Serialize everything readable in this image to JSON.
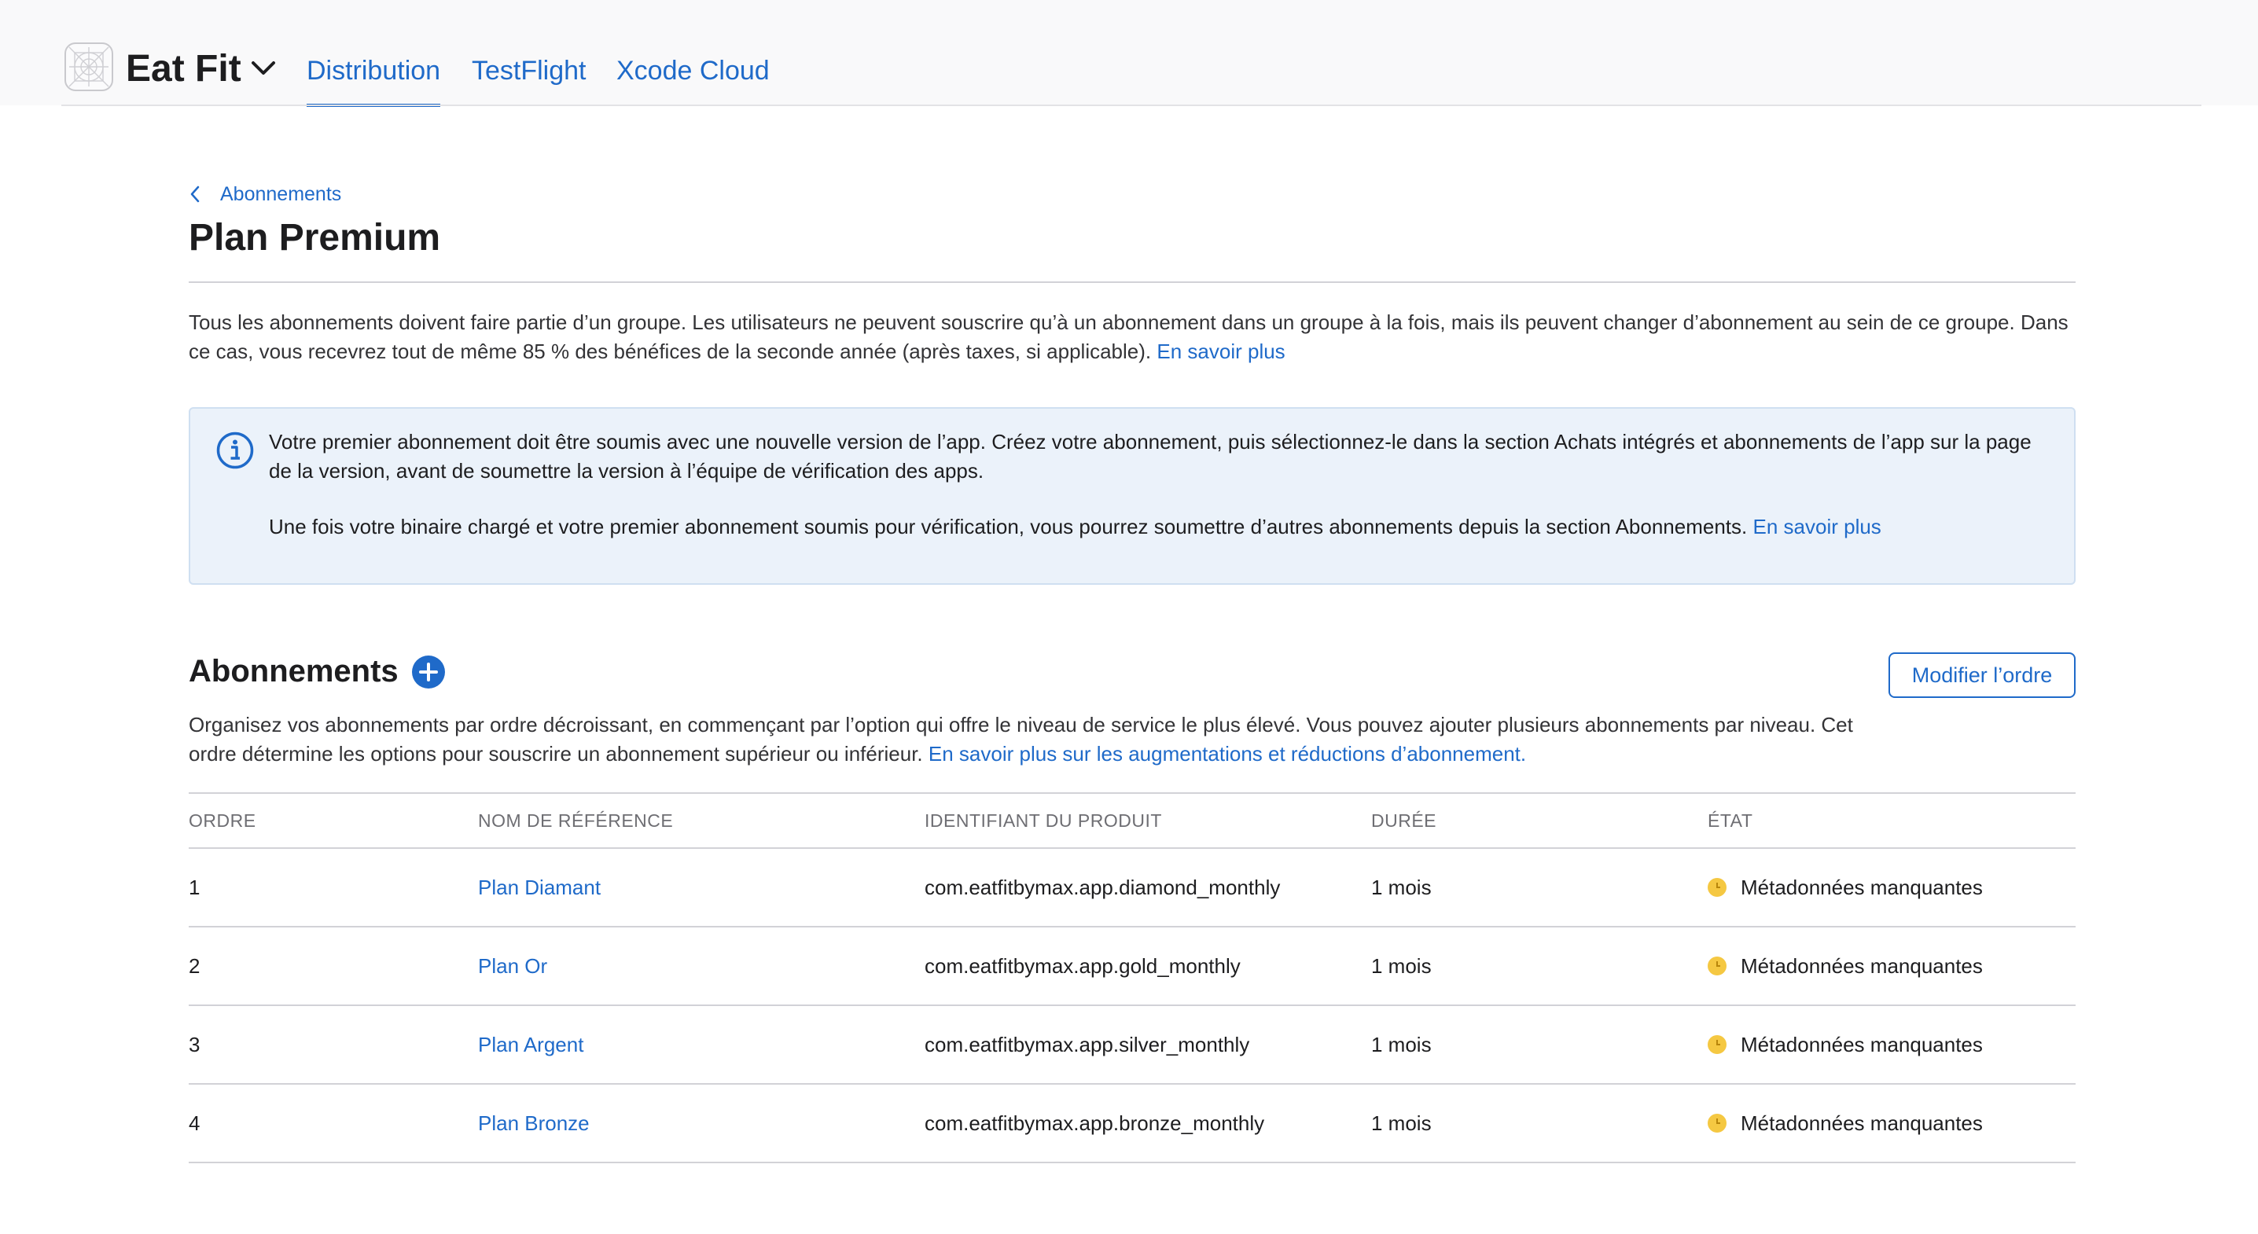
{
  "header": {
    "app_name": "Eat Fit",
    "tabs": [
      {
        "label": "Distribution",
        "active": true
      },
      {
        "label": "TestFlight",
        "active": false
      },
      {
        "label": "Xcode Cloud",
        "active": false
      }
    ]
  },
  "breadcrumb": {
    "label": "Abonnements"
  },
  "page": {
    "title": "Plan Premium"
  },
  "intro": {
    "text": "Tous les abonnements doivent faire partie d’un groupe. Les utilisateurs ne peuvent souscrire qu’à un abonnement dans un groupe à la fois, mais ils peuvent changer d’abonnement au sein de ce groupe. Dans ce cas, vous recevrez tout de même 85 % des bénéfices de la seconde année (après taxes, si applicable).",
    "link": "En savoir plus"
  },
  "info": {
    "paragraph1": "Votre premier abonnement doit être soumis avec une nouvelle version de l’app. Créez votre abonnement, puis sélectionnez-le dans la section Achats intégrés et abonnements de l’app sur la page de la version, avant de soumettre la version à l’équipe de vérification des apps.",
    "paragraph2": "Une fois votre binaire chargé et votre premier abonnement soumis pour vérification, vous pourrez soumettre d’autres abonnements depuis la section Abonnements.",
    "link": "En savoir plus"
  },
  "subscriptions": {
    "title": "Abonnements",
    "reorder_button": "Modifier l’ordre",
    "description": "Organisez vos abonnements par ordre décroissant, en commençant par l’option qui offre le niveau de service le plus élevé. Vous pouvez ajouter plusieurs abonnements par niveau. Cet ordre détermine les options pour souscrire un abonnement supérieur ou inférieur.",
    "description_link": "En savoir plus sur les augmentations et réductions d’abonnement.",
    "columns": [
      "ORDRE",
      "NOM DE RÉFÉRENCE",
      "IDENTIFIANT DU PRODUIT",
      "DURÉE",
      "ÉTAT"
    ],
    "rows": [
      {
        "order": "1",
        "name": "Plan Diamant",
        "product_id": "com.eatfitbymax.app.diamond_monthly",
        "duration": "1 mois",
        "status": "Métadonnées manquantes"
      },
      {
        "order": "2",
        "name": "Plan Or",
        "product_id": "com.eatfitbymax.app.gold_monthly",
        "duration": "1 mois",
        "status": "Métadonnées manquantes"
      },
      {
        "order": "3",
        "name": "Plan Argent",
        "product_id": "com.eatfitbymax.app.silver_monthly",
        "duration": "1 mois",
        "status": "Métadonnées manquantes"
      },
      {
        "order": "4",
        "name": "Plan Bronze",
        "product_id": "com.eatfitbymax.app.bronze_monthly",
        "duration": "1 mois",
        "status": "Métadonnées manquantes"
      }
    ]
  },
  "colors": {
    "accent": "#1f6ac9",
    "status_warning": "#f5c842",
    "info_bg": "#ebf2fa"
  }
}
